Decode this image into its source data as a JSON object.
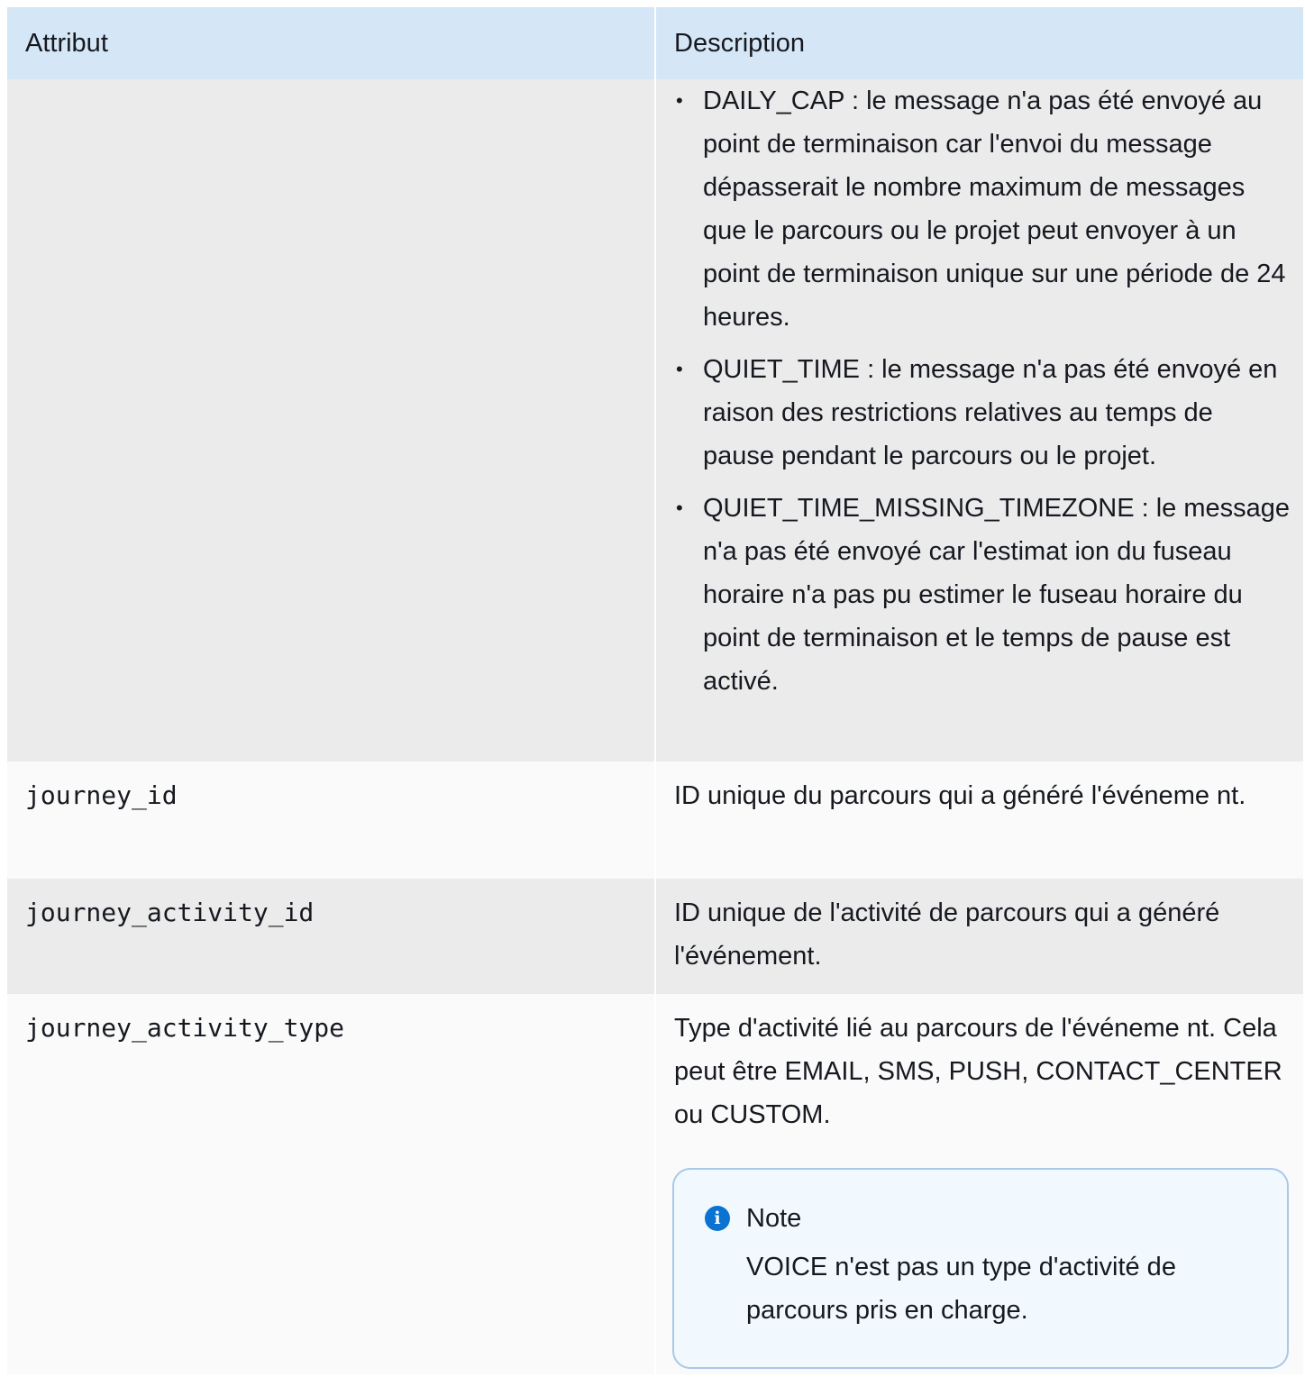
{
  "table": {
    "headers": {
      "attribute": "Attribut",
      "description": "Description"
    },
    "continued_list": [
      "DAILY_CAP : le message n'a pas été envoyé au point de terminaison car l'envoi du message dépasserait le nombre maximum de messages que le parcours ou le projet peut envoyer à un point de terminaison unique sur une période de 24 heures.",
      "QUIET_TIME : le message n'a pas été envoyé en raison des restrictions relatives au temps de pause pendant le parcours ou le projet.",
      "QUIET_TIME_MISSING_TIMEZONE : le message n'a pas été envoyé car l'estimat ion du fuseau horaire n'a pas pu estimer le fuseau horaire du point de terminaison et le temps de pause est activé."
    ],
    "rows": [
      {
        "attribute": "journey_id",
        "description": "ID unique du parcours qui a généré l'événeme nt."
      },
      {
        "attribute": "journey_activity_id",
        "description": "ID unique de l'activité de parcours qui a généré l'événement."
      },
      {
        "attribute": "journey_activity_type",
        "description": "Type d'activité lié au parcours de l'événeme nt. Cela peut être EMAIL, SMS, PUSH, CONTACT_CENTER ou CUSTOM.",
        "note": {
          "icon": "info-icon",
          "title": "Note",
          "text": "VOICE n'est pas un type d'activité de parcours pris en charge."
        }
      }
    ]
  },
  "colors": {
    "header_bg": "#d5e6f6",
    "row_gray": "#ebebec",
    "row_white": "#fafafa",
    "note_border": "#a8c9e8",
    "note_bg": "#f1f8fe",
    "info_icon": "#0972d3"
  }
}
